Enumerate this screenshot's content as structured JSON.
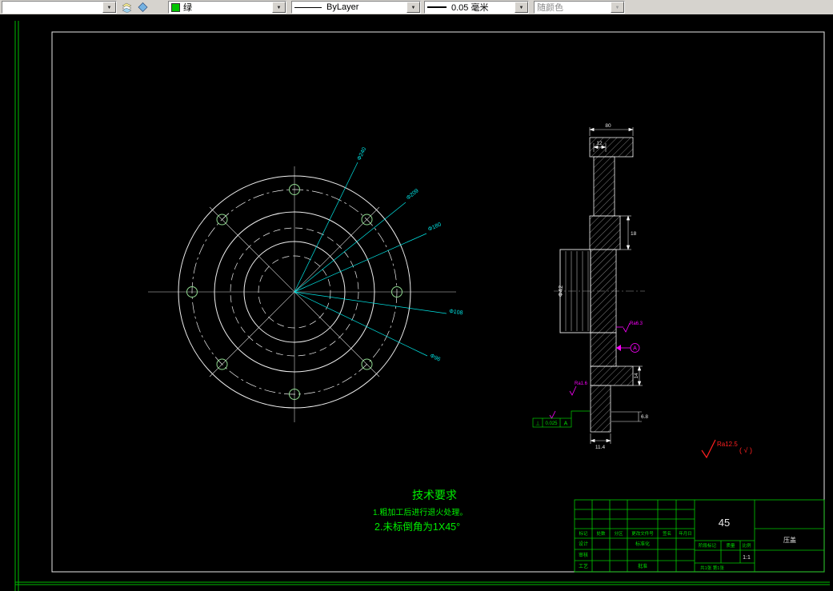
{
  "toolbar": {
    "layer_value": "",
    "color_value": "绿",
    "linetype_value": "ByLayer",
    "lineweight_value": "0.05 毫米",
    "plotstyle_value": "随颜色"
  },
  "front_view": {
    "dims": [
      "Φ240",
      "Φ209",
      "Φ180",
      "Φ108",
      "Φ96"
    ]
  },
  "section": {
    "dim_80": "80",
    "dim_12": "12",
    "dim_18": "18",
    "dim_phi42": "Φ42",
    "dim_14": "14",
    "dim_68": "6.8",
    "dim_114": "11.4",
    "ra_63": "Ra6.3",
    "ra_16": "Ra1.6",
    "datum": "A",
    "gdt_symbol": "⊥",
    "gdt_value": "0.025",
    "gdt_datum": "A"
  },
  "notes": {
    "tech_title": "技术要求",
    "item1": "1.粗加工后进行退火处理。",
    "item2": "2.未标倒角为1X45°",
    "surface": "Ra12.5",
    "surface_suffix": "( √ )"
  },
  "title_block": {
    "material": "45",
    "part_name": "压盖",
    "scale_value": "1:1",
    "rev_headers": [
      "标记",
      "处数",
      "分区",
      "更改文件号",
      "签名",
      "年月日"
    ],
    "sig_rows": [
      {
        "left": "设计",
        "right": "标准化"
      },
      {
        "left": "审核",
        "right": ""
      },
      {
        "left": "工艺",
        "right": "批准"
      }
    ],
    "stage_label": "阶段标记",
    "mass_label": "质量",
    "scale_label": "比例",
    "sheet_info": "共1张 第1张"
  }
}
